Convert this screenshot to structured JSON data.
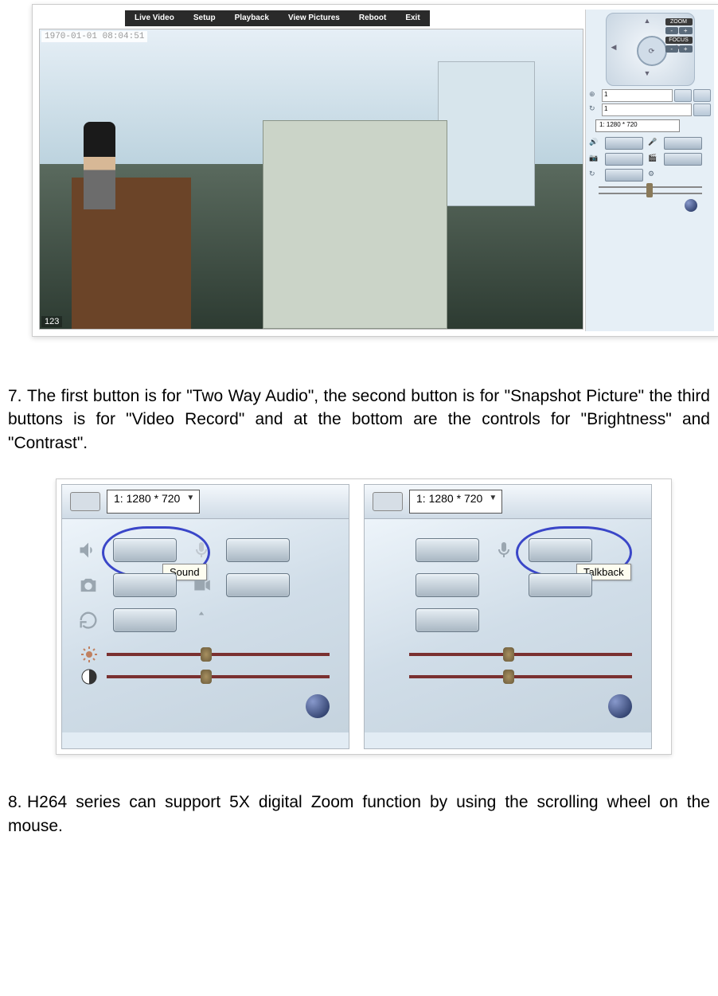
{
  "menu": [
    "Live Video",
    "Setup",
    "Playback",
    "View Pictures",
    "Reboot",
    "Exit"
  ],
  "video": {
    "timestamp": "1970-01-01 08:04:51",
    "channel": "123"
  },
  "sidebar": {
    "zoom_label": "ZOOM",
    "focus_label": "FOCUS",
    "minus": "-",
    "plus": "+",
    "preset1": "1",
    "preset2": "1",
    "resolution": "1: 1280 * 720"
  },
  "para7": {
    "num": "7.",
    "text": "The first button is for \"Two Way Audio\", the second button is for \"Snapshot Picture\" the third buttons is for \"Video Record\" and at the bottom are the controls for \"Brightness\" and \"Contrast\"."
  },
  "dual": {
    "resolution": "1: 1280 * 720",
    "tooltip_sound": "Sound",
    "tooltip_talkback": "Talkback"
  },
  "para8": {
    "num": "8.",
    "text": "H264 series can support 5X digital Zoom function by using the scrolling wheel on the mouse."
  }
}
